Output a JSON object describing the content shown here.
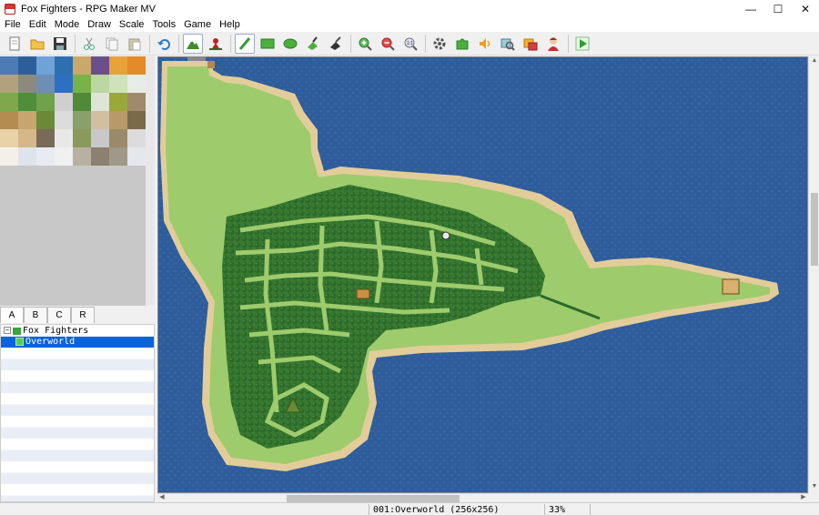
{
  "window": {
    "title": "Fox Fighters - RPG Maker MV",
    "controls": [
      "—",
      "☐",
      "✕"
    ]
  },
  "menu": [
    "File",
    "Edit",
    "Mode",
    "Draw",
    "Scale",
    "Tools",
    "Game",
    "Help"
  ],
  "toolbar": [
    {
      "icon": "new-project-icon"
    },
    {
      "icon": "open-project-icon"
    },
    {
      "icon": "save-project-icon"
    },
    {
      "icon": "cut-icon"
    },
    {
      "icon": "copy-icon"
    },
    {
      "icon": "paste-icon"
    },
    {
      "icon": "undo-icon"
    },
    {
      "icon": "map-mode-icon",
      "active": true
    },
    {
      "icon": "event-mode-icon"
    },
    {
      "icon": "pencil-icon",
      "active": true
    },
    {
      "icon": "rectangle-icon"
    },
    {
      "icon": "ellipse-icon"
    },
    {
      "icon": "fill-icon"
    },
    {
      "icon": "shadow-pen-icon"
    },
    {
      "icon": "zoom-in-icon"
    },
    {
      "icon": "zoom-out-icon"
    },
    {
      "icon": "actual-size-icon"
    },
    {
      "icon": "database-icon"
    },
    {
      "icon": "plugin-manager-icon"
    },
    {
      "icon": "sound-test-icon"
    },
    {
      "icon": "event-searcher-icon"
    },
    {
      "icon": "resource-manager-icon"
    },
    {
      "icon": "character-generator-icon"
    },
    {
      "icon": "playtest-icon"
    }
  ],
  "tileset": {
    "tabs": [
      "A",
      "B",
      "C",
      "R"
    ],
    "active_tab": "A",
    "tiles": [
      "#4d7bb5",
      "#2c5f9a",
      "#6fa2d6",
      "#2d6fb0",
      "#c9a86a",
      "#6b4f8a",
      "#e7a23a",
      "#e48a28",
      "#b0a27a",
      "#8c8a7c",
      "#6d8fb5",
      "#2d6fc0",
      "#7ab24a",
      "#bcd7a0",
      "#cfe2bc",
      "#e8ece8",
      "#7fa84a",
      "#4f8e3a",
      "#6fa24a",
      "#cfcfcf",
      "#4e8a3a",
      "#dfe4d8",
      "#9aa83a",
      "#a08a6a",
      "#b48c52",
      "#c6a56e",
      "#6a8a3a",
      "#dcdcdc",
      "#8aa06a",
      "#d0c0a0",
      "#b89a6a",
      "#7a6a4a",
      "#e8d2a8",
      "#d4b88a",
      "#7a6a5a",
      "#e8e8e8",
      "#8a9a5a",
      "#c8c8c8",
      "#9a8a6a",
      "#dcdcdc",
      "#f4f0e8",
      "#dde4ec",
      "#e8ecf2",
      "#f0f0f0",
      "#b8b0a0",
      "#8c8070",
      "#a09888",
      "#e4e8ee"
    ]
  },
  "tree": [
    {
      "label": "Fox Fighters",
      "icon": "project-folder-icon",
      "expander": "−"
    },
    {
      "label": "Overworld",
      "icon": "map-icon",
      "selected": true
    }
  ],
  "status": {
    "map": "001:Overworld (256x256)",
    "zoom": "33%"
  },
  "colors": {
    "sea": "#2f5c9b",
    "grass": "#9ecb6c",
    "sand": "#e2cd9a",
    "forest": "#2d6a2e",
    "selection": "#0a64d8"
  }
}
